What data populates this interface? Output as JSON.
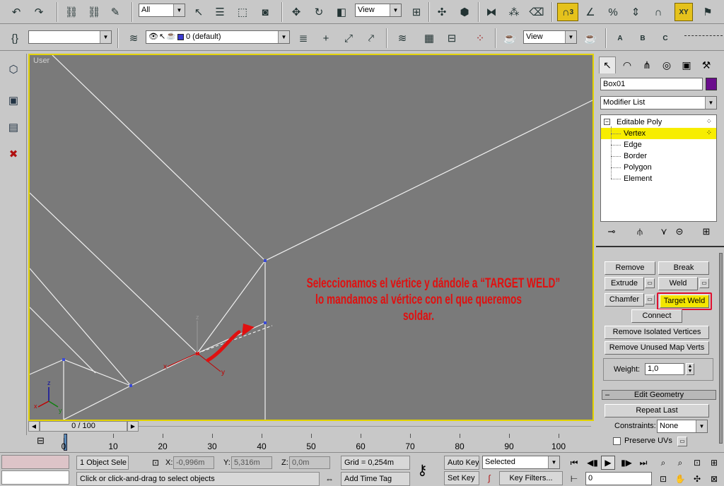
{
  "toolbar1": {
    "selection_filter": "All",
    "ref_coord": "View",
    "snap_label": "3",
    "axis_label": "XY",
    "icons": [
      "undo-icon",
      "redo-icon",
      "link-icon",
      "unlink-icon",
      "bind-spacewarp-icon",
      "select-arrow-icon",
      "select-by-name-icon",
      "rect-region-icon",
      "window-crossing-icon",
      "move-icon",
      "rotate-icon",
      "scale-icon",
      "pivot-icon",
      "mirror-icon",
      "align-icon",
      "layer-manager-icon"
    ]
  },
  "toolbar2": {
    "layer_dropdown": "",
    "layer_name": "0 (default)",
    "render_view": "View",
    "teapot_labels": [
      "A",
      "B",
      "C"
    ]
  },
  "viewport": {
    "label": "User",
    "annotation_lines": [
      "Seleccionamos el vértice y dándole a “TARGET WELD”",
      "lo mandamos al vértice con el que queremos",
      "soldar."
    ],
    "gizmo_labels": {
      "x": "x",
      "y": "y",
      "z": "z"
    },
    "accent_color": "#e3d300",
    "annotation_color": "#e01010"
  },
  "timeslider": {
    "frame_display": "0 / 100"
  },
  "trackbar": {
    "ticks": [
      "0",
      "10",
      "20",
      "30",
      "40",
      "50",
      "60",
      "70",
      "80",
      "90",
      "100"
    ]
  },
  "command_panel": {
    "object_name": "Box01",
    "object_color": "#6a0d8c",
    "modifier_list": "Modifier List",
    "stack": {
      "root": "Editable Poly",
      "items": [
        "Vertex",
        "Edge",
        "Border",
        "Polygon",
        "Element"
      ],
      "selected": "Vertex"
    },
    "buttons": {
      "remove": "Remove",
      "break": "Break",
      "extrude": "Extrude",
      "weld": "Weld",
      "chamfer": "Chamfer",
      "target_weld": "Target Weld",
      "connect": "Connect",
      "remove_isolated": "Remove Isolated Vertices",
      "remove_unused": "Remove Unused Map Verts",
      "repeat_last": "Repeat Last"
    },
    "weight_label": "Weight:",
    "weight_value": "1,0",
    "edit_geometry_title": "Edit Geometry",
    "constraints_label": "Constraints:",
    "constraints_value": "None",
    "preserve_uvs": "Preserve UVs"
  },
  "statusbar": {
    "selection_count": "1 Object Sele",
    "x_label": "X:",
    "x_value": "-0,996m",
    "y_label": "Y:",
    "y_value": "5,316m",
    "z_label": "Z:",
    "z_value": "0,0m",
    "grid": "Grid = 0,254m",
    "prompt": "Click or click-and-drag to select objects",
    "add_time_tag": "Add Time Tag",
    "auto_key": "Auto Key",
    "set_key": "Set Key",
    "key_mode": "Selected",
    "key_filters": "Key Filters...",
    "current_frame": "0"
  }
}
